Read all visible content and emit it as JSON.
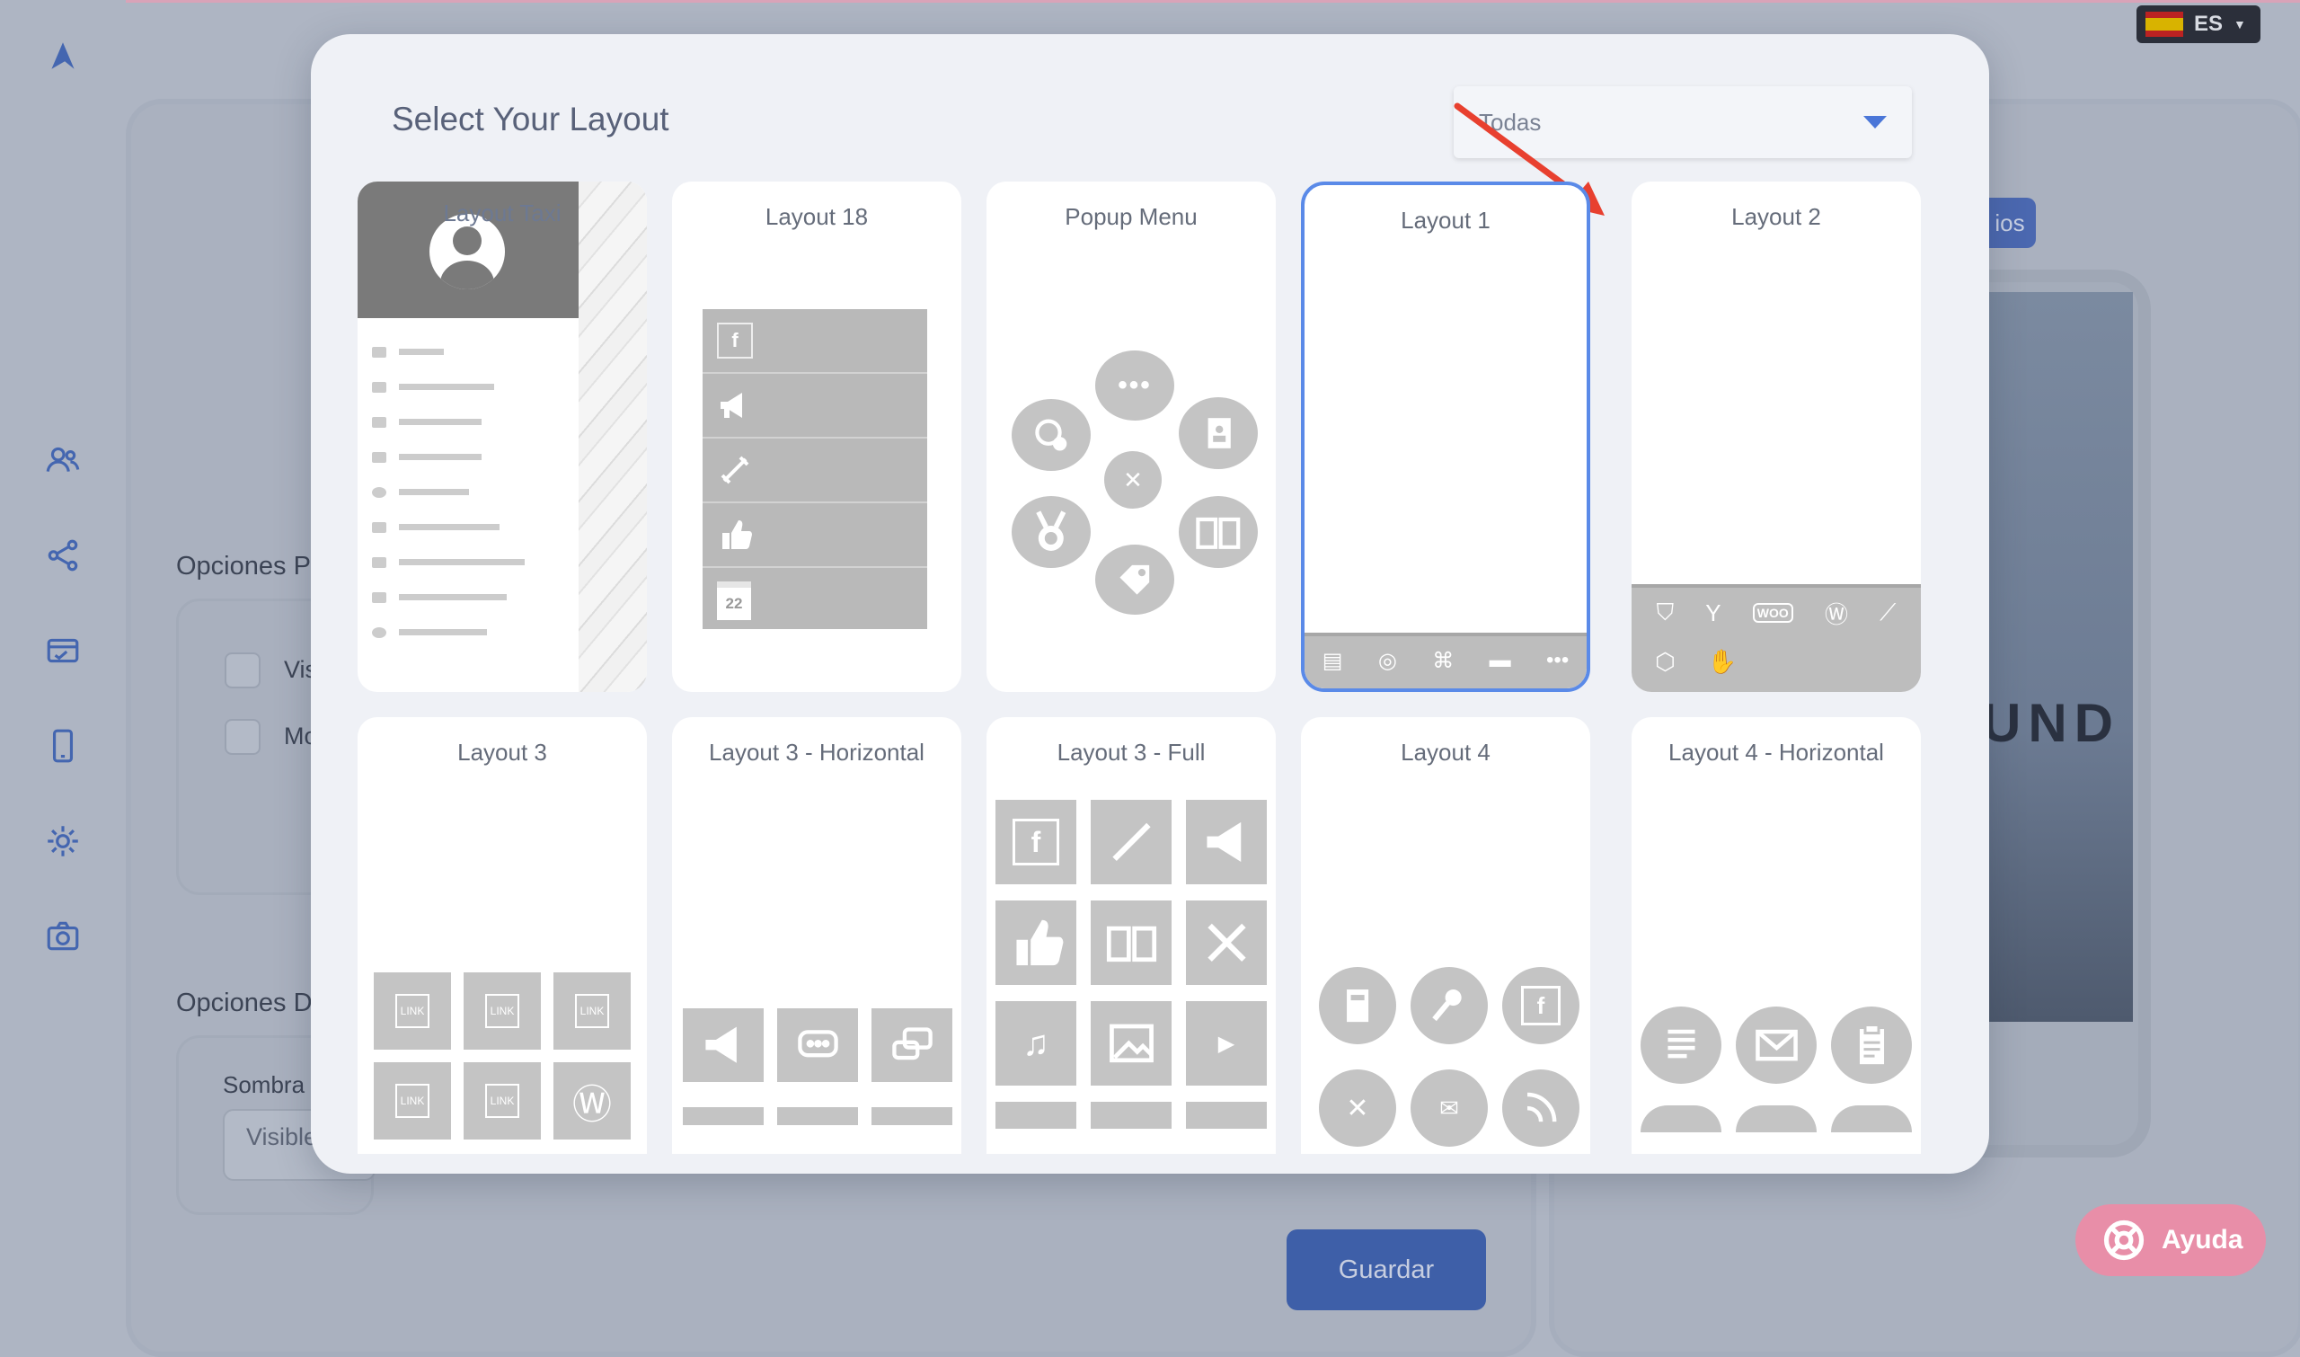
{
  "app": {
    "language": "ES",
    "sidebar_icons": [
      "app-logo-icon",
      "users-icon",
      "share-icon",
      "card-icon",
      "phone-icon",
      "gear-icon",
      "camera-icon"
    ],
    "section_options_1": "Opciones P",
    "checkbox_1_label": "Vis",
    "checkbox_2_label": "Mo",
    "section_options_2": "Opciones D",
    "shadow_label": "Sombra",
    "shadow_value": "Visible",
    "save_label": "Guardar",
    "ios_label": "ios",
    "phone_text": "UND",
    "help_label": "Ayuda"
  },
  "modal": {
    "title": "Select Your Layout",
    "filter": {
      "selected": "Todas"
    },
    "layouts": [
      {
        "name": "Layout Taxi"
      },
      {
        "name": "Layout 18",
        "icons": [
          "facebook-icon",
          "megaphone-icon",
          "link-icon",
          "thumbs-up-icon",
          "calendar-icon"
        ],
        "calendar_day": "22"
      },
      {
        "name": "Popup Menu",
        "icons": [
          "more-icon",
          "contact-book-icon",
          "book-icon",
          "tag-icon",
          "medal-icon",
          "support-icon",
          "close-icon"
        ]
      },
      {
        "name": "Layout 1",
        "selected": true,
        "icons": [
          "document-icon",
          "support-icon",
          "translate-icon",
          "ticket-icon",
          "more-icon"
        ]
      },
      {
        "name": "Layout 2",
        "icons": [
          "shopify-icon",
          "yoast-icon",
          "woo-icon",
          "wordpress-icon",
          "link-icon",
          "magento-icon",
          "hand-icon"
        ],
        "woo_label": "WOO"
      },
      {
        "name": "Layout 3",
        "icons": [
          "link-page-icon",
          "link-page-icon",
          "link-page-icon",
          "link-page-icon",
          "link-page-icon",
          "wordpress-icon"
        ],
        "link_label": "LINK"
      },
      {
        "name": "Layout 3 - Horizontal",
        "icons": [
          "megaphone-icon",
          "chat-icon",
          "chat-icon"
        ]
      },
      {
        "name": "Layout 3 - Full",
        "icons": [
          "facebook-icon",
          "link-icon",
          "megaphone-icon",
          "thumbs-up-icon",
          "book-icon",
          "tools-icon",
          "music-icon",
          "image-icon",
          "video-icon"
        ]
      },
      {
        "name": "Layout 4",
        "icons": [
          "contact-icon",
          "microphone-icon",
          "facebook-icon",
          "medal-icon",
          "mail-icon",
          "rss-icon"
        ]
      },
      {
        "name": "Layout 4 - Horizontal",
        "icons": [
          "notes-icon",
          "mail-icon",
          "clipboard-icon"
        ]
      }
    ]
  },
  "colors": {
    "accent": "#5a8ae8",
    "selected_border": "#5a8ae8",
    "placeholder_gray": "#c4c4c4",
    "annotation_arrow": "#e8402f",
    "help_button": "#e88ea8",
    "save_button": "#3e5fa8"
  }
}
